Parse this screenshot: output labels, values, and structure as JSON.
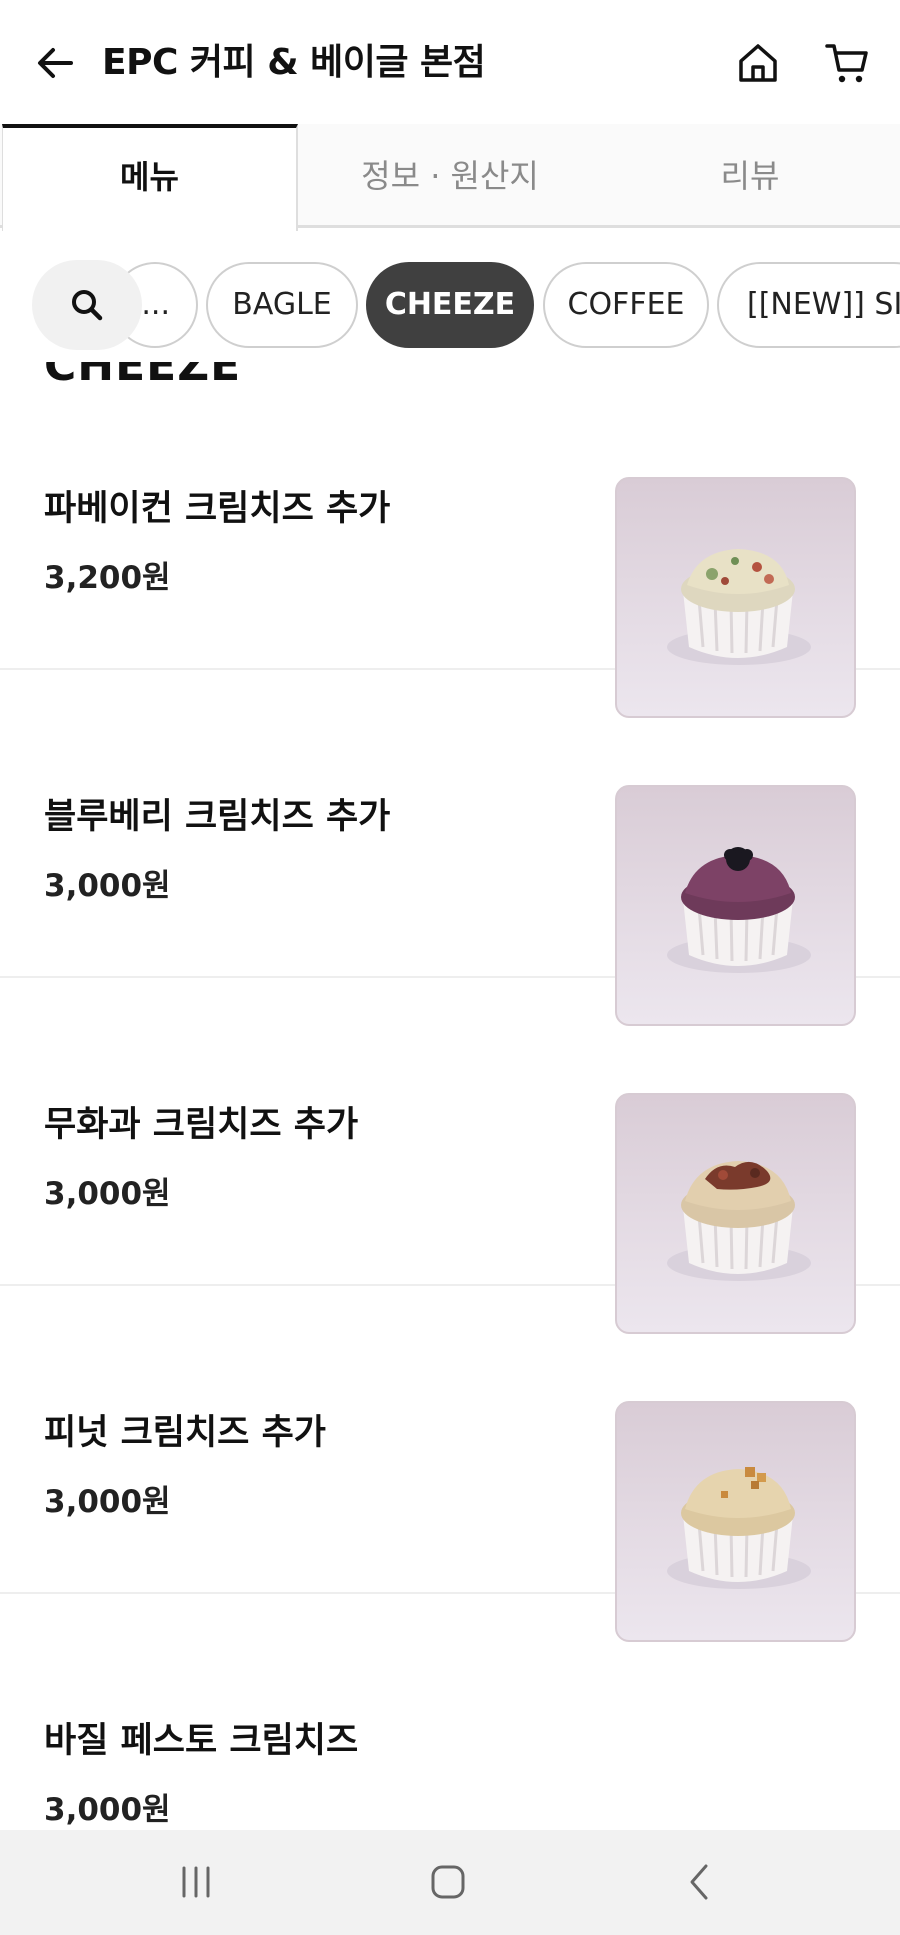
{
  "header": {
    "title": "EPC 커피 & 베이글 본점",
    "back_icon": "arrow-left-icon",
    "home_icon": "home-icon",
    "cart_icon": "cart-icon"
  },
  "tabs": [
    {
      "label": "메뉴",
      "active": true
    },
    {
      "label": "정보 · 원산지",
      "active": false
    },
    {
      "label": "리뷰",
      "active": false
    }
  ],
  "category_chips": {
    "search_icon": "search-icon",
    "items": [
      {
        "label": "...",
        "active": false
      },
      {
        "label": "BAGLE",
        "active": false
      },
      {
        "label": "CHEEZE",
        "active": true
      },
      {
        "label": "COFFEE",
        "active": false
      },
      {
        "label": "[[NEW]]   SI",
        "active": false
      }
    ]
  },
  "section": {
    "title": "CHEEZE"
  },
  "menu_items": [
    {
      "name": "파베이컨 크림치즈 추가",
      "price": "3,200원",
      "image": "bacon-cream-cheese-photo"
    },
    {
      "name": "블루베리 크림치즈 추가",
      "price": "3,000원",
      "image": "blueberry-cream-cheese-photo"
    },
    {
      "name": "무화과 크림치즈 추가",
      "price": "3,000원",
      "image": "fig-cream-cheese-photo"
    },
    {
      "name": "피넛 크림치즈 추가",
      "price": "3,000원",
      "image": "peanut-cream-cheese-photo"
    },
    {
      "name": "바질 페스토 크림치즈",
      "price": "3,000원",
      "image": null
    }
  ],
  "system_nav": {
    "recent_icon": "recent-apps-icon",
    "home_icon": "system-home-icon",
    "back_icon": "system-back-icon"
  },
  "colors": {
    "active_chip_bg": "#404040",
    "active_tab_border": "#111111",
    "photo_bg": "#ddd2dc"
  }
}
